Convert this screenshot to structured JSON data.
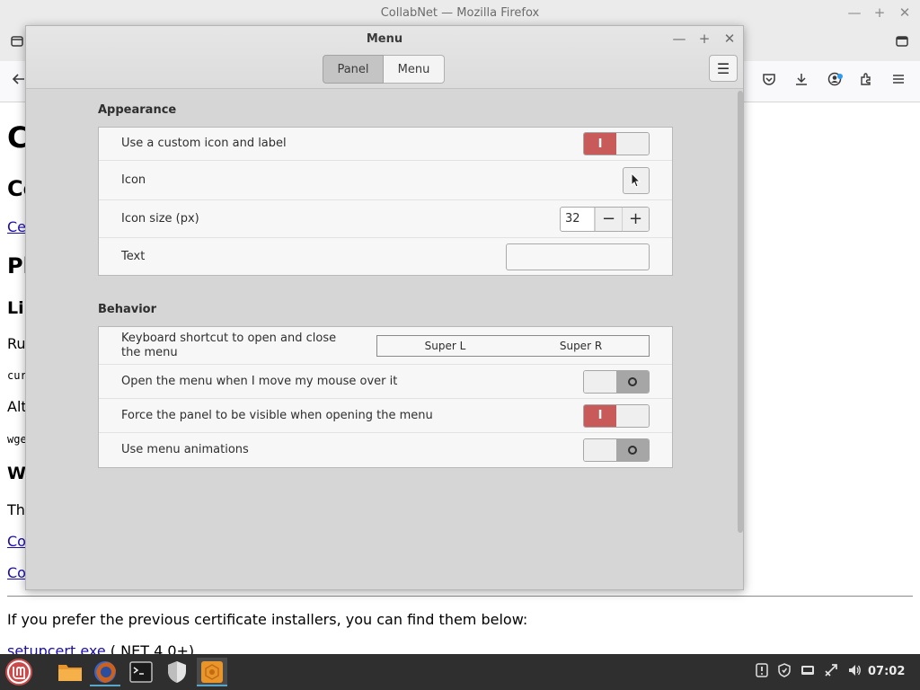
{
  "firefox": {
    "window_title": "CollabNet — Mozilla Firefox",
    "minimize_glyph": "—",
    "maximize_glyph": "+",
    "close_glyph": "✕"
  },
  "webpage": {
    "heading_1": "C",
    "heading_2": "Co",
    "link_1": "Ce",
    "heading_3": "Pl",
    "heading_4": "Li",
    "para_1": "Ru",
    "code_1": "cur",
    "para_2": "Alt",
    "code_2": "wge",
    "heading_5": "W",
    "para_3": "Th",
    "link_2": "Co",
    "link_3": "Co",
    "bottom_text": "If you prefer the previous certificate installers, you can find them below:",
    "bottom_link": "setupcert.exe",
    "bottom_link_suffix": " (.NET 4.0+)"
  },
  "dialog": {
    "title": "Menu",
    "minimize_glyph": "—",
    "maximize_glyph": "+",
    "close_glyph": "✕",
    "tabs": [
      {
        "label": "Panel",
        "active": true
      },
      {
        "label": "Menu",
        "active": false
      }
    ],
    "hamburger_glyph": "☰"
  },
  "appearance": {
    "title": "Appearance",
    "rows": [
      {
        "label": "Use a custom icon and label",
        "toggle_on": true
      },
      {
        "label": "Icon"
      },
      {
        "label": "Icon size (px)",
        "value": "32",
        "minus": "−",
        "plus": "+"
      },
      {
        "label": "Text",
        "value": ""
      }
    ],
    "toggle_on_glyph": "I"
  },
  "behavior": {
    "title": "Behavior",
    "rows": [
      {
        "label": "Keyboard shortcut to open and close the menu",
        "key_1": "Super L",
        "key_2": "Super R"
      },
      {
        "label": "Open the menu when I move my mouse over it",
        "toggle_on": false
      },
      {
        "label": "Force the panel to be visible when opening the menu",
        "toggle_on": true
      },
      {
        "label": "Use menu animations",
        "toggle_on": false
      }
    ]
  },
  "taskbar": {
    "clock": "07:02"
  },
  "colors": {
    "toggle_on": "#c85a5a",
    "taskbar_bg": "#2f2f2f",
    "menu_button": "#c94b4b"
  }
}
